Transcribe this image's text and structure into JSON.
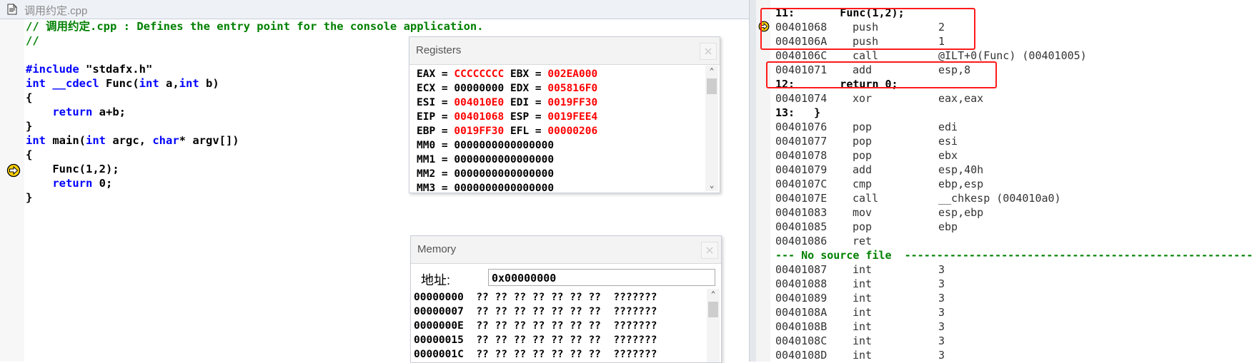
{
  "source_window": {
    "title": "调用约定.cpp",
    "lines": [
      "// 调用约定.cpp : Defines the entry point for the console application.",
      "//",
      "",
      "#include \"stdafx.h\"",
      "int __cdecl Func(int a,int b)",
      "{",
      "    return a+b;",
      "}",
      "int main(int argc, char* argv[])",
      "{",
      "    Func(1,2);",
      "    return 0;",
      "}"
    ]
  },
  "registers": {
    "title": "Registers",
    "rows": [
      {
        "l_name": "EAX",
        "l_val": "CCCCCCCC",
        "l_changed": true,
        "r_name": "EBX",
        "r_val": "002EA000",
        "r_changed": true
      },
      {
        "l_name": "ECX",
        "l_val": "00000000",
        "l_changed": false,
        "r_name": "EDX",
        "r_val": "005816F0",
        "r_changed": true
      },
      {
        "l_name": "ESI",
        "l_val": "004010E0",
        "l_changed": true,
        "r_name": "EDI",
        "r_val": "0019FF30",
        "r_changed": true
      },
      {
        "l_name": "EIP",
        "l_val": "00401068",
        "l_changed": true,
        "r_name": "ESP",
        "r_val": "0019FEE4",
        "r_changed": true
      },
      {
        "l_name": "EBP",
        "l_val": "0019FF30",
        "l_changed": true,
        "r_name": "EFL",
        "r_val": "00000206",
        "r_changed": true
      },
      {
        "l_name": "MM0",
        "l_val": "0000000000000000",
        "l_changed": false
      },
      {
        "l_name": "MM1",
        "l_val": "0000000000000000",
        "l_changed": false
      },
      {
        "l_name": "MM2",
        "l_val": "0000000000000000",
        "l_changed": false
      },
      {
        "l_name": "MM3",
        "l_val": "0000000000000000",
        "l_changed": false
      }
    ],
    "changed_color": "#ff0000"
  },
  "memory": {
    "title": "Memory",
    "address_label": "地址:",
    "address_value": "0x00000000",
    "rows": [
      {
        "addr": "00000000",
        "bytes": "?? ?? ?? ?? ?? ?? ??",
        "ascii": "???????"
      },
      {
        "addr": "00000007",
        "bytes": "?? ?? ?? ?? ?? ?? ??",
        "ascii": "???????"
      },
      {
        "addr": "0000000E",
        "bytes": "?? ?? ?? ?? ?? ?? ??",
        "ascii": "???????"
      },
      {
        "addr": "00000015",
        "bytes": "?? ?? ?? ?? ?? ?? ??",
        "ascii": "???????"
      },
      {
        "addr": "0000001C",
        "bytes": "?? ?? ?? ?? ?? ?? ??",
        "ascii": "???????"
      }
    ]
  },
  "disassembly": {
    "lines": [
      {
        "kind": "src",
        "text": "11:       Func(1,2);"
      },
      {
        "kind": "asm",
        "addr": "00401068",
        "mnem": "push",
        "ops": "2"
      },
      {
        "kind": "asm",
        "addr": "0040106A",
        "mnem": "push",
        "ops": "1"
      },
      {
        "kind": "asm",
        "addr": "0040106C",
        "mnem": "call",
        "ops": "@ILT+0(Func) (00401005)"
      },
      {
        "kind": "asm",
        "addr": "00401071",
        "mnem": "add",
        "ops": "esp,8"
      },
      {
        "kind": "src",
        "text": "12:       return 0;"
      },
      {
        "kind": "asm",
        "addr": "00401074",
        "mnem": "xor",
        "ops": "eax,eax"
      },
      {
        "kind": "src",
        "text": "13:   }"
      },
      {
        "kind": "asm",
        "addr": "00401076",
        "mnem": "pop",
        "ops": "edi"
      },
      {
        "kind": "asm",
        "addr": "00401077",
        "mnem": "pop",
        "ops": "esi"
      },
      {
        "kind": "asm",
        "addr": "00401078",
        "mnem": "pop",
        "ops": "ebx"
      },
      {
        "kind": "asm",
        "addr": "00401079",
        "mnem": "add",
        "ops": "esp,40h"
      },
      {
        "kind": "asm",
        "addr": "0040107C",
        "mnem": "cmp",
        "ops": "ebp,esp"
      },
      {
        "kind": "asm",
        "addr": "0040107E",
        "mnem": "call",
        "ops": "__chkesp (004010a0)"
      },
      {
        "kind": "asm",
        "addr": "00401083",
        "mnem": "mov",
        "ops": "esp,ebp"
      },
      {
        "kind": "asm",
        "addr": "00401085",
        "mnem": "pop",
        "ops": "ebp"
      },
      {
        "kind": "asm",
        "addr": "00401086",
        "mnem": "ret",
        "ops": ""
      },
      {
        "kind": "nosrc",
        "text": "--- No source file  ----------------------------------------------------------"
      },
      {
        "kind": "asm",
        "addr": "00401087",
        "mnem": "int",
        "ops": "3"
      },
      {
        "kind": "asm",
        "addr": "00401088",
        "mnem": "int",
        "ops": "3"
      },
      {
        "kind": "asm",
        "addr": "00401089",
        "mnem": "int",
        "ops": "3"
      },
      {
        "kind": "asm",
        "addr": "0040108A",
        "mnem": "int",
        "ops": "3"
      },
      {
        "kind": "asm",
        "addr": "0040108B",
        "mnem": "int",
        "ops": "3"
      },
      {
        "kind": "asm",
        "addr": "0040108C",
        "mnem": "int",
        "ops": "3"
      },
      {
        "kind": "asm",
        "addr": "0040108D",
        "mnem": "int",
        "ops": "3"
      }
    ],
    "highlight_color": "#ff1a1a"
  },
  "icons": {
    "title_icon": "source-file-icon",
    "exec_marker": "current-instruction-arrow-icon",
    "marker_color": "#ffd200"
  }
}
